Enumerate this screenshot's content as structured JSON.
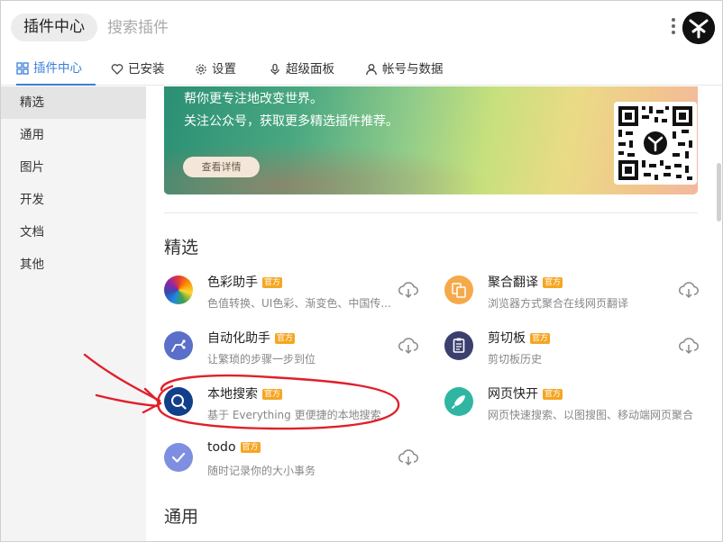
{
  "header": {
    "app_title": "插件中心",
    "search_placeholder": "搜索插件"
  },
  "tabs": [
    {
      "label": "插件中心",
      "icon": "grid-icon",
      "active": true
    },
    {
      "label": "已安装",
      "icon": "heart-icon"
    },
    {
      "label": "设置",
      "icon": "gear-icon"
    },
    {
      "label": "超级面板",
      "icon": "mic-icon"
    },
    {
      "label": "帐号与数据",
      "icon": "user-icon"
    }
  ],
  "sidebar": {
    "items": [
      {
        "label": "精选",
        "active": true
      },
      {
        "label": "通用"
      },
      {
        "label": "图片"
      },
      {
        "label": "开发"
      },
      {
        "label": "文档"
      },
      {
        "label": "其他"
      }
    ]
  },
  "banner": {
    "line1": "帮你更专注地改变世界。",
    "line2": "关注公众号，获取更多精选插件推荐。",
    "button": "查看详情"
  },
  "sections": {
    "featured_title": "精选",
    "general_title": "通用"
  },
  "plugins": [
    {
      "name": "色彩助手",
      "badge": "官方",
      "desc": "色值转换、UI色彩、渐变色、中国传...",
      "icon": "color-wheel-icon",
      "color": "#e53935"
    },
    {
      "name": "聚合翻译",
      "badge": "官方",
      "desc": "浏览器方式聚合在线网页翻译",
      "icon": "translate-icon",
      "color": "#f6a94a"
    },
    {
      "name": "自动化助手",
      "badge": "官方",
      "desc": "让繁琐的步骤一步到位",
      "icon": "automation-icon",
      "color": "#5a6fc9"
    },
    {
      "name": "剪切板",
      "badge": "官方",
      "desc": "剪切板历史",
      "icon": "clipboard-icon",
      "color": "#3b3f6e"
    },
    {
      "name": "本地搜索",
      "badge": "官方",
      "desc": "基于 Everything 更便捷的本地搜索",
      "icon": "search-icon",
      "color": "#123f8a"
    },
    {
      "name": "网页快开",
      "badge": "官方",
      "desc": "网页快速搜索、以图搜图、移动端网页聚合",
      "icon": "rocket-icon",
      "color": "#2fb6a3"
    },
    {
      "name": "todo",
      "badge": "官方",
      "desc": "随时记录你的大小事务",
      "icon": "check-icon",
      "color": "#7e8ee0"
    }
  ],
  "colors": {
    "accent": "#3b7fd6",
    "badge": "#f5a623",
    "annotation": "#e0202a"
  }
}
